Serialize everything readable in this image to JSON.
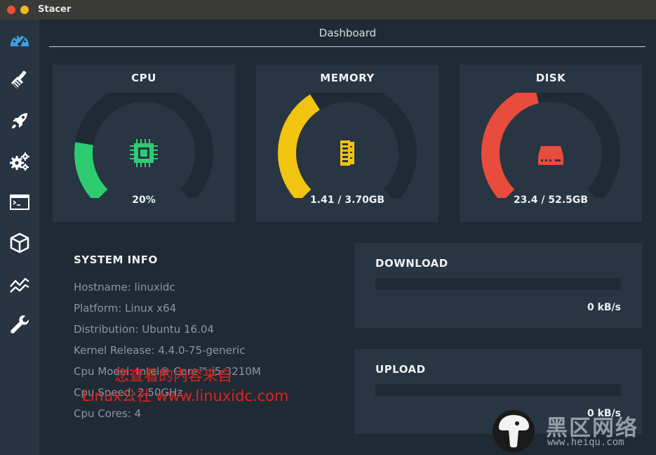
{
  "window": {
    "title": "Stacer"
  },
  "sidebar": {
    "items": [
      {
        "icon": "dashboard-icon"
      },
      {
        "icon": "system-cleaner-icon"
      },
      {
        "icon": "startup-apps-icon"
      },
      {
        "icon": "services-icon"
      },
      {
        "icon": "processes-icon"
      },
      {
        "icon": "uninstaller-icon"
      },
      {
        "icon": "resources-icon"
      },
      {
        "icon": "settings-icon"
      }
    ]
  },
  "dashboard": {
    "title": "Dashboard",
    "gauges": [
      {
        "label": "CPU",
        "value": "20%",
        "percent": 20,
        "color": "#2ecc71",
        "icon": "cpu-chip-icon"
      },
      {
        "label": "MEMORY",
        "value": "1.41 / 3.70GB",
        "percent": 38,
        "color": "#f1c40f",
        "icon": "memory-module-icon"
      },
      {
        "label": "DISK",
        "value": "23.4 / 52.5GB",
        "percent": 45,
        "color": "#e74c3c",
        "icon": "hard-disk-icon"
      }
    ],
    "system_info": {
      "title": "SYSTEM INFO",
      "rows": [
        "Hostname: linuxidc",
        "Platform: Linux x64",
        "Distribution: Ubuntu 16.04",
        "Kernel Release: 4.4.0-75-generic",
        "Cpu Model: Intel® Core™ i5-3210M",
        "Cpu Speed: 2.50GHz",
        "Cpu Cores: 4"
      ]
    },
    "network": [
      {
        "title": "DOWNLOAD",
        "value": "0 kB/s",
        "percent": 0
      },
      {
        "title": "UPLOAD",
        "value": "0 kB/s",
        "percent": 0
      }
    ]
  },
  "overlay": {
    "line1": "您查看的内容来自",
    "line2": "Linux公社 www.linuxidc.com"
  },
  "watermark": {
    "name": "黑区网络",
    "url": "www.heiqu.com"
  },
  "colors": {
    "background": "#1f2a35",
    "card": "#283543",
    "sidebar": "#273442",
    "track": "#1f2a35",
    "accent_blue": "#3aa0e0"
  }
}
